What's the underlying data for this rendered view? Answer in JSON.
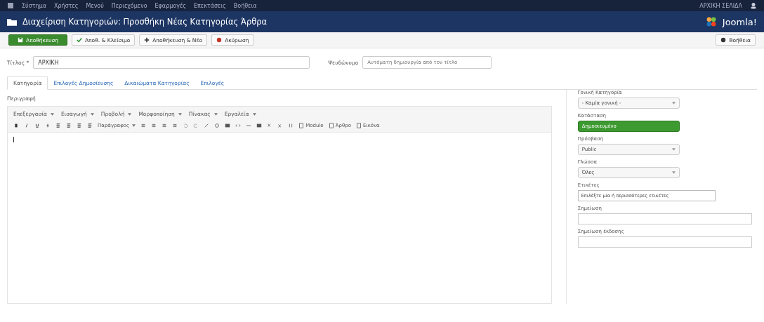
{
  "top_menu": {
    "items": [
      "Σύστημα",
      "Χρήστες",
      "Μενού",
      "Περιεχόμενο",
      "Εφαρμογές",
      "Επεκτάσεις",
      "Βοήθεια"
    ],
    "site_link": "ΑΡΧΙΚΗ ΣΕΛΙΔΑ"
  },
  "header": {
    "title": "Διαχείριση Κατηγοριών: Προσθήκη Νέας Κατηγορίας Άρθρα",
    "logo_text": "Joomla!"
  },
  "toolbar": {
    "buttons": [
      {
        "label": "Αποθήκευση",
        "kind": "primary"
      },
      {
        "label": "Αποθ. & Κλείσιμο",
        "kind": "check"
      },
      {
        "label": "Αποθήκευση & Νέο",
        "kind": "plus"
      },
      {
        "label": "Ακύρωση",
        "kind": "cancel"
      }
    ],
    "help": "Βοήθεια"
  },
  "title_field": {
    "label": "Τίτλος *",
    "value": "ΑΡΧΙΚΗ"
  },
  "alias_field": {
    "label": "Ψευδώνυμο",
    "placeholder": "Αυτόματη δημιουργία από τον τίτλο"
  },
  "tabs": [
    {
      "label": "Κατηγορία",
      "selected": true
    },
    {
      "label": "Επιλογές Δημοσίευσης",
      "selected": false
    },
    {
      "label": "Δικαιώματα Κατηγορίας",
      "selected": false
    },
    {
      "label": "Επιλογές",
      "selected": false
    }
  ],
  "editor": {
    "label": "Περιγραφή",
    "menus": [
      "Επεξεργασία",
      "Εισαγωγή",
      "Προβολή",
      "Μορφοποίηση",
      "Πίνακας",
      "Εργαλεία"
    ],
    "format": "Παράγραφος",
    "inserts": [
      "Module",
      "Άρθρο",
      "Εικόνα"
    ]
  },
  "sidebar": [
    {
      "label": "Γονική Κατηγορία",
      "kind": "select",
      "value": "- Καμία γονική -"
    },
    {
      "label": "Κατάσταση",
      "kind": "status",
      "value": "Δημοσιευμένο"
    },
    {
      "label": "Πρόσβαση",
      "kind": "select",
      "value": "Public"
    },
    {
      "label": "Γλώσσα",
      "kind": "select",
      "value": "Όλες"
    },
    {
      "label": "Ετικέτες",
      "kind": "tags",
      "value": "Επιλέξτε μία ή περισσότερες ετικέτες"
    },
    {
      "label": "Σημείωση",
      "kind": "text"
    },
    {
      "label": "Σημείωση έκδοσης",
      "kind": "text"
    }
  ]
}
